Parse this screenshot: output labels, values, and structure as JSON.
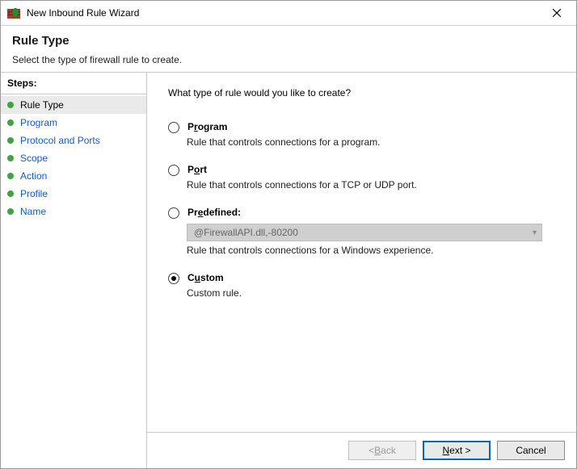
{
  "window": {
    "title": "New Inbound Rule Wizard"
  },
  "header": {
    "title": "Rule Type",
    "subtitle": "Select the type of firewall rule to create."
  },
  "steps": {
    "heading": "Steps:",
    "items": [
      {
        "label": "Rule Type",
        "current": true
      },
      {
        "label": "Program"
      },
      {
        "label": "Protocol and Ports"
      },
      {
        "label": "Scope"
      },
      {
        "label": "Action"
      },
      {
        "label": "Profile"
      },
      {
        "label": "Name"
      }
    ]
  },
  "content": {
    "question": "What type of rule would you like to create?",
    "options": {
      "program": {
        "label_pre": "P",
        "label_accel": "r",
        "label_post": "ogram",
        "desc": "Rule that controls connections for a program."
      },
      "port": {
        "label_pre": "P",
        "label_accel": "o",
        "label_post": "rt",
        "desc": "Rule that controls connections for a TCP or UDP port."
      },
      "predefined": {
        "label_pre": "Pr",
        "label_accel": "e",
        "label_post": "defined:",
        "dropdown": "@FirewallAPI.dll,-80200",
        "desc": "Rule that controls connections for a Windows experience."
      },
      "custom": {
        "label_pre": "C",
        "label_accel": "u",
        "label_post": "stom",
        "desc": "Custom rule."
      }
    },
    "selected": "custom"
  },
  "footer": {
    "back_pre": "< ",
    "back_accel": "B",
    "back_post": "ack",
    "next_pre": "",
    "next_accel": "N",
    "next_post": "ext >",
    "cancel": "Cancel"
  }
}
